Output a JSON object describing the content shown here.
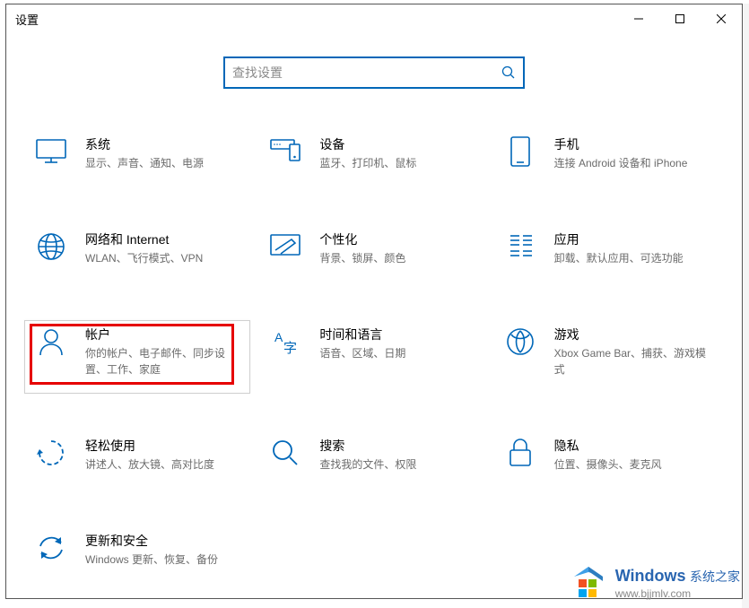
{
  "window": {
    "title": "设置"
  },
  "search": {
    "placeholder": "查找设置"
  },
  "cards": [
    {
      "icon": "system",
      "title": "系统",
      "desc": "显示、声音、通知、电源"
    },
    {
      "icon": "devices",
      "title": "设备",
      "desc": "蓝牙、打印机、鼠标"
    },
    {
      "icon": "phone",
      "title": "手机",
      "desc": "连接 Android 设备和 iPhone"
    },
    {
      "icon": "network",
      "title": "网络和 Internet",
      "desc": "WLAN、飞行模式、VPN"
    },
    {
      "icon": "personal",
      "title": "个性化",
      "desc": "背景、锁屏、颜色"
    },
    {
      "icon": "apps",
      "title": "应用",
      "desc": "卸载、默认应用、可选功能"
    },
    {
      "icon": "accounts",
      "title": "帐户",
      "desc": "你的帐户、电子邮件、同步设置、工作、家庭"
    },
    {
      "icon": "time",
      "title": "时间和语言",
      "desc": "语音、区域、日期"
    },
    {
      "icon": "gaming",
      "title": "游戏",
      "desc": "Xbox Game Bar、捕获、游戏模式"
    },
    {
      "icon": "ease",
      "title": "轻松使用",
      "desc": "讲述人、放大镜、高对比度"
    },
    {
      "icon": "searchc",
      "title": "搜索",
      "desc": "查找我的文件、权限"
    },
    {
      "icon": "privacy",
      "title": "隐私",
      "desc": "位置、摄像头、麦克风"
    },
    {
      "icon": "update",
      "title": "更新和安全",
      "desc": "Windows 更新、恢复、备份"
    }
  ],
  "watermark": {
    "brand_en": "Windows",
    "brand_cn": "系统之家",
    "url": "www.bjjmlv.com"
  },
  "colors": {
    "accent": "#0067b8",
    "highlight": "#e60000"
  }
}
